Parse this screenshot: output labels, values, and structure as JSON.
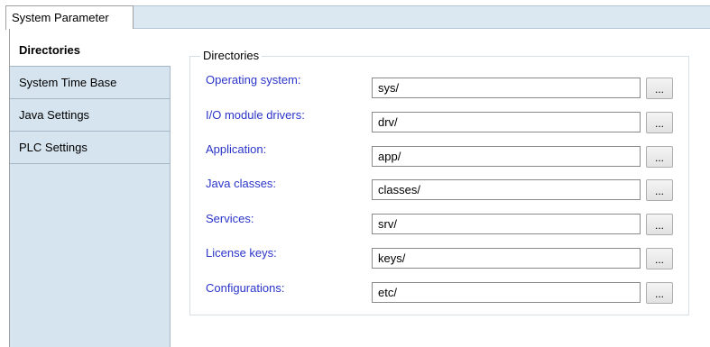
{
  "tab": {
    "label": "System Parameter"
  },
  "sidebar": {
    "items": [
      {
        "label": "Directories",
        "active": true
      },
      {
        "label": "System Time Base",
        "active": false
      },
      {
        "label": "Java Settings",
        "active": false
      },
      {
        "label": "PLC Settings",
        "active": false
      }
    ]
  },
  "group": {
    "title": "Directories",
    "rows": [
      {
        "label": "Operating system:",
        "value": "sys/",
        "button": "..."
      },
      {
        "label": "I/O module drivers:",
        "value": "drv/",
        "button": "..."
      },
      {
        "label": "Application:",
        "value": "app/",
        "button": "..."
      },
      {
        "label": "Java classes:",
        "value": "classes/",
        "button": "..."
      },
      {
        "label": "Services:",
        "value": "srv/",
        "button": "..."
      },
      {
        "label": "License keys:",
        "value": "keys/",
        "button": "..."
      },
      {
        "label": "Configurations:",
        "value": "etc/",
        "button": "..."
      }
    ]
  },
  "colors": {
    "label_link": "#2b35c8",
    "sidebar_bg": "#d6e4ef",
    "tabstrip_bg": "#dbe7f1"
  }
}
